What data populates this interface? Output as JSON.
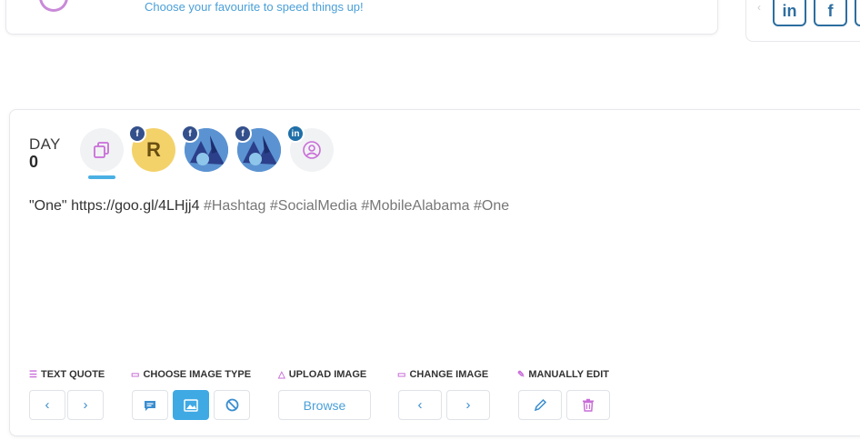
{
  "top": {
    "hint": "Choose your favourite to speed things up!",
    "social": [
      "in",
      "f"
    ]
  },
  "day": {
    "label": "DAY",
    "number": "0"
  },
  "post": {
    "quote": "\"One\"",
    "url": "https://goo.gl/4LHjj4",
    "hashtags": "#Hashtag #SocialMedia #MobileAlabama #One"
  },
  "avatars": {
    "r_initial": "R",
    "badges": [
      "f",
      "f",
      "f",
      "in"
    ]
  },
  "toolbar": {
    "text_quote": "TEXT QUOTE",
    "choose_image_type": "CHOOSE IMAGE TYPE",
    "upload_image": "UPLOAD IMAGE",
    "change_image": "CHANGE IMAGE",
    "manually_edit": "MANUALLY EDIT",
    "browse": "Browse"
  },
  "colors": {
    "accent": "#3fa9e4",
    "pink": "#c96ed8",
    "facebook_badge": "#34508c",
    "linkedin_badge": "#1f6fa8"
  }
}
